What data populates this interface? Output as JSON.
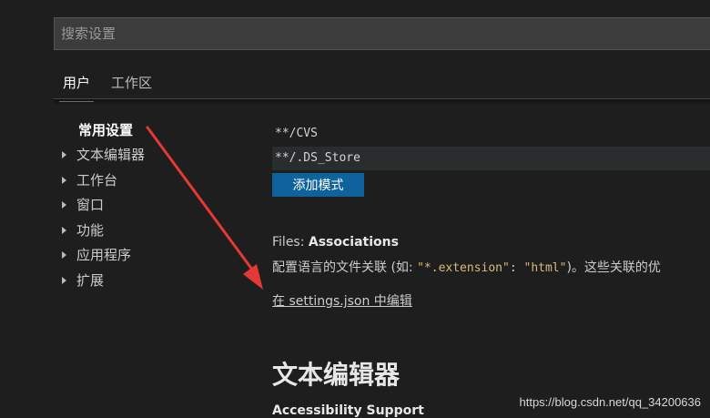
{
  "search": {
    "placeholder": "搜索设置"
  },
  "tabs": [
    {
      "label": "用户",
      "active": true
    },
    {
      "label": "工作区",
      "active": false
    }
  ],
  "toc": [
    {
      "label": "常用设置",
      "selected": true
    },
    {
      "label": "文本编辑器"
    },
    {
      "label": "工作台"
    },
    {
      "label": "窗口"
    },
    {
      "label": "功能"
    },
    {
      "label": "应用程序"
    },
    {
      "label": "扩展"
    }
  ],
  "exclude_patterns": [
    "**/CVS",
    "**/.DS_Store"
  ],
  "add_pattern_button": "添加模式",
  "associations": {
    "category": "Files: ",
    "name": "Associations",
    "desc_prefix": "配置语言的文件关联 (如: ",
    "code_key": "\"*.extension\"",
    "code_sep": ": ",
    "code_value": "\"html\"",
    "desc_suffix": ")。这些关联的优",
    "edit_link": "在 settings.json 中编辑"
  },
  "section_title": "文本编辑器",
  "next_setting": "Accessibility Support",
  "watermark": "https://blog.csdn.net/qq_34200636",
  "colors": {
    "background": "#1e1e1e",
    "input_bg": "#3c3c3c",
    "button_bg": "#0e639c",
    "annotation_arrow": "#e53935"
  }
}
